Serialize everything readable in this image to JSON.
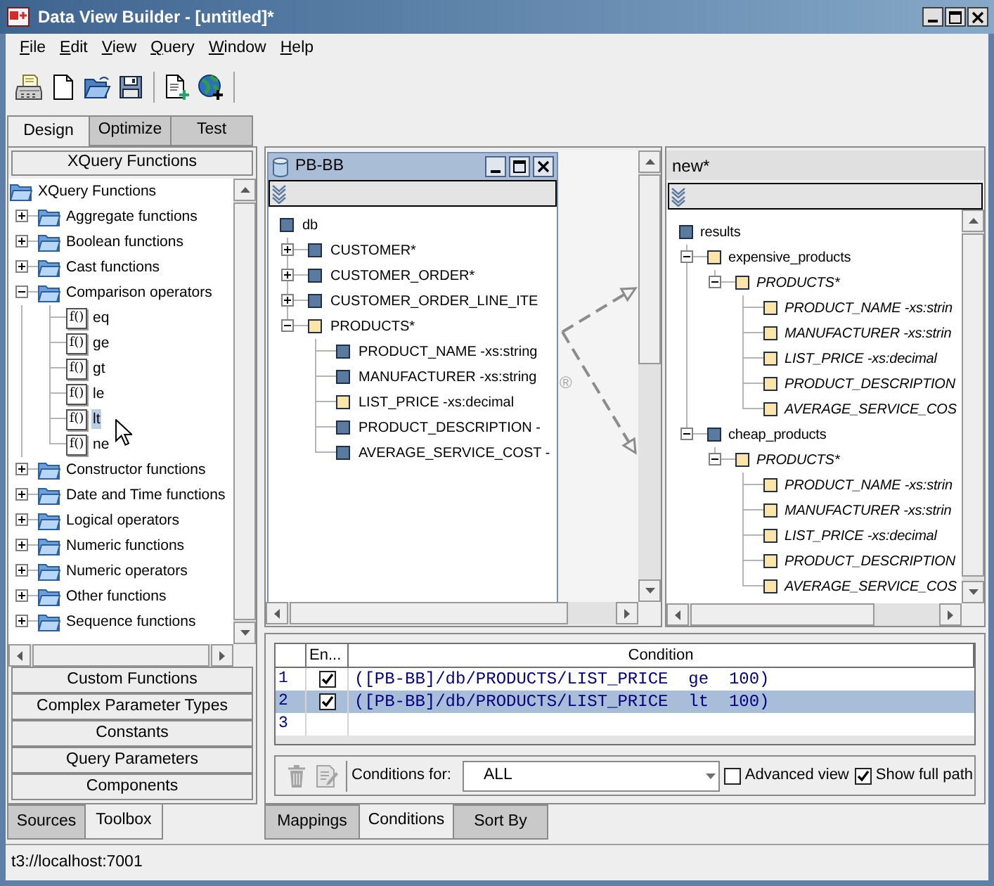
{
  "window": {
    "title": "Data View Builder - [untitled]*"
  },
  "menu": [
    "File",
    "Edit",
    "View",
    "Query",
    "Window",
    "Help"
  ],
  "view_tabs": [
    {
      "label": "Design",
      "selected": true
    },
    {
      "label": "Optimize",
      "selected": false
    },
    {
      "label": "Test",
      "selected": false
    }
  ],
  "toolbox": {
    "header": "XQuery Functions",
    "tree": {
      "label": "XQuery Functions",
      "kind": "folder",
      "selected": false,
      "children": [
        {
          "label": "Aggregate functions",
          "kind": "folder",
          "expanded": false,
          "selected": false
        },
        {
          "label": "Boolean functions",
          "kind": "folder",
          "expanded": false,
          "selected": false
        },
        {
          "label": "Cast functions",
          "kind": "folder",
          "expanded": false,
          "selected": false
        },
        {
          "label": "Comparison operators",
          "kind": "folder",
          "expanded": true,
          "selected": false,
          "children": [
            {
              "label": "eq",
              "kind": "function",
              "icon_text": "f()",
              "selected": false
            },
            {
              "label": "ge",
              "kind": "function",
              "icon_text": "f()",
              "selected": false
            },
            {
              "label": "gt",
              "kind": "function",
              "icon_text": "f()",
              "selected": false
            },
            {
              "label": "le",
              "kind": "function",
              "icon_text": "f()",
              "selected": false
            },
            {
              "label": "lt",
              "kind": "function",
              "icon_text": "f()",
              "selected": true
            },
            {
              "label": "ne",
              "kind": "function",
              "icon_text": "f()",
              "selected": false
            }
          ]
        },
        {
          "label": "Constructor functions",
          "kind": "folder",
          "expanded": false,
          "selected": false
        },
        {
          "label": "Date and Time functions",
          "kind": "folder",
          "expanded": false,
          "selected": false
        },
        {
          "label": "Logical operators",
          "kind": "folder",
          "expanded": false,
          "selected": false
        },
        {
          "label": "Numeric functions",
          "kind": "folder",
          "expanded": false,
          "selected": false
        },
        {
          "label": "Numeric operators",
          "kind": "folder",
          "expanded": false,
          "selected": false
        },
        {
          "label": "Other functions",
          "kind": "folder",
          "expanded": false,
          "selected": false
        },
        {
          "label": "Sequence functions",
          "kind": "folder",
          "expanded": false,
          "selected": false
        }
      ]
    },
    "sections": [
      "Custom Functions",
      "Complex Parameter Types",
      "Constants",
      "Query Parameters",
      "Components"
    ]
  },
  "panel_tabs": [
    {
      "label": "Sources",
      "selected": false
    },
    {
      "label": "Toolbox",
      "selected": true
    }
  ],
  "source_frame": {
    "title": "PB-BB",
    "tree": {
      "label": "db",
      "color": "#5a7aa0",
      "children": [
        {
          "label": "CUSTOMER*",
          "color": "#5a7aa0",
          "expanded": false
        },
        {
          "label": "CUSTOMER_ORDER*",
          "color": "#5a7aa0",
          "expanded": false
        },
        {
          "label": "CUSTOMER_ORDER_LINE_ITE",
          "color": "#5a7aa0",
          "expanded": false
        },
        {
          "label": "PRODUCTS*",
          "color": "#fde4a8",
          "expanded": true,
          "children": [
            {
              "label": "PRODUCT_NAME -xs:string",
              "color": "#5a7aa0"
            },
            {
              "label": "MANUFACTURER -xs:string",
              "color": "#5a7aa0"
            },
            {
              "label": "LIST_PRICE -xs:decimal",
              "color": "#fde4a8"
            },
            {
              "label": "PRODUCT_DESCRIPTION -",
              "color": "#5a7aa0"
            },
            {
              "label": "AVERAGE_SERVICE_COST -",
              "color": "#5a7aa0"
            }
          ]
        }
      ]
    },
    "canvas_mark": "®"
  },
  "target_panel": {
    "title": "new*",
    "tree": {
      "label": "results",
      "color": "#5a7aa0",
      "italic": false,
      "children": [
        {
          "label": "expensive_products",
          "color": "#fde4a8",
          "italic": false,
          "expanded": true,
          "children": [
            {
              "label": "PRODUCTS*",
              "color": "#fde4a8",
              "italic": true,
              "expanded": true,
              "children": [
                {
                  "label": "PRODUCT_NAME -xs:strin",
                  "color": "#fde4a8",
                  "italic": true
                },
                {
                  "label": "MANUFACTURER -xs:strin",
                  "color": "#fde4a8",
                  "italic": true
                },
                {
                  "label": "LIST_PRICE -xs:decimal",
                  "color": "#fde4a8",
                  "italic": true
                },
                {
                  "label": "PRODUCT_DESCRIPTION",
                  "color": "#fde4a8",
                  "italic": true
                },
                {
                  "label": "AVERAGE_SERVICE_COS",
                  "color": "#fde4a8",
                  "italic": true
                }
              ]
            }
          ]
        },
        {
          "label": "cheap_products",
          "color": "#5a7aa0",
          "italic": false,
          "expanded": true,
          "children": [
            {
              "label": "PRODUCTS*",
              "color": "#fde4a8",
              "italic": true,
              "expanded": true,
              "children": [
                {
                  "label": "PRODUCT_NAME -xs:strin",
                  "color": "#fde4a8",
                  "italic": true
                },
                {
                  "label": "MANUFACTURER -xs:strin",
                  "color": "#fde4a8",
                  "italic": true
                },
                {
                  "label": "LIST_PRICE -xs:decimal",
                  "color": "#fde4a8",
                  "italic": true
                },
                {
                  "label": "PRODUCT_DESCRIPTION",
                  "color": "#fde4a8",
                  "italic": true
                },
                {
                  "label": "AVERAGE_SERVICE_COS",
                  "color": "#fde4a8",
                  "italic": true
                }
              ]
            }
          ]
        }
      ]
    }
  },
  "conditions": {
    "columns": [
      "En...",
      "Condition"
    ],
    "rows": [
      {
        "number": "1",
        "enabled": true,
        "condition": "([PB-BB]/db/PRODUCTS/LIST_PRICE  ge  100)",
        "selected": false
      },
      {
        "number": "2",
        "enabled": true,
        "condition": "([PB-BB]/db/PRODUCTS/LIST_PRICE  lt  100)",
        "selected": true
      },
      {
        "number": "3",
        "selected": false
      }
    ],
    "tools": [
      {
        "kind": "trash",
        "disabled": true
      },
      {
        "kind": "edit",
        "disabled": true
      }
    ],
    "filter": {
      "label": "Conditions for:",
      "value": "ALL"
    },
    "options": [
      {
        "label": "Advanced view",
        "checked": false
      },
      {
        "label": "Show full path",
        "checked": true
      }
    ]
  },
  "bottom_tabs": [
    {
      "label": "Mappings",
      "selected": false
    },
    {
      "label": "Conditions",
      "selected": true
    },
    {
      "label": "Sort By",
      "selected": false
    }
  ],
  "status_bar": "t3://localhost:7001"
}
